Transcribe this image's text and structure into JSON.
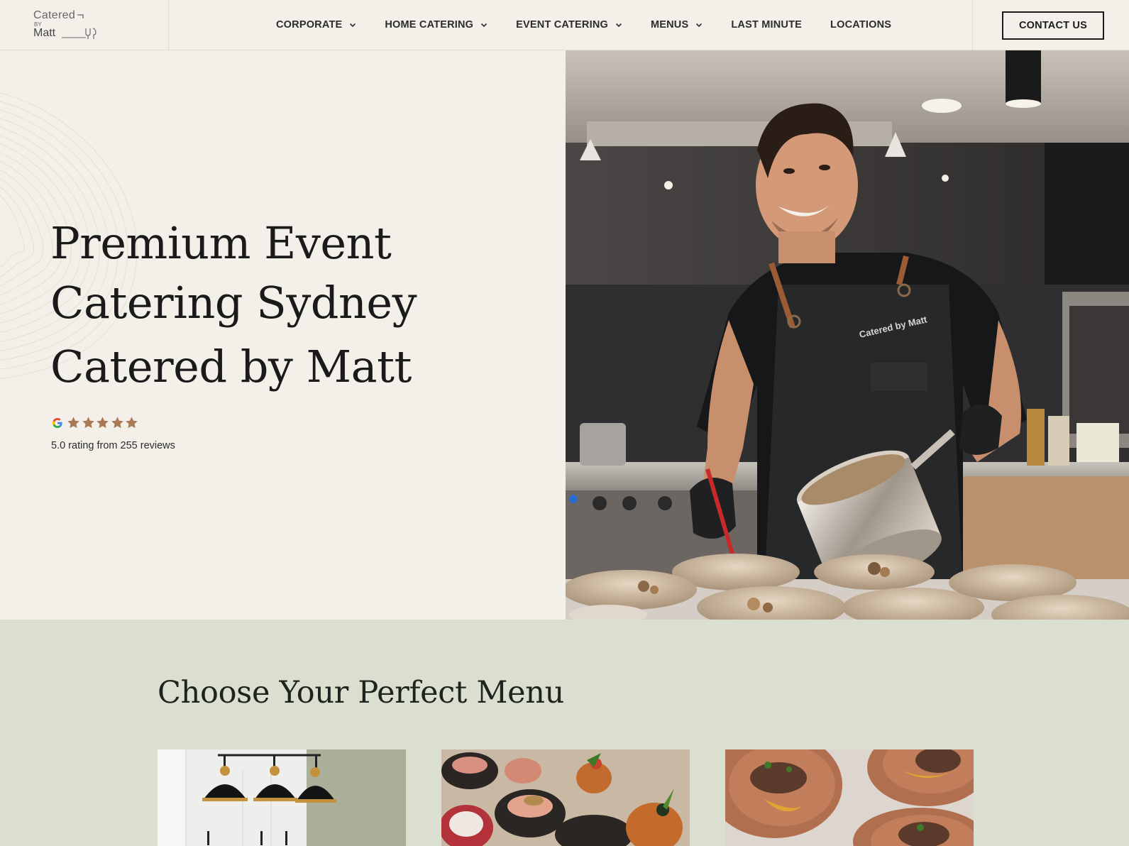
{
  "brand": {
    "logo_line1": "Catered",
    "logo_line2": "BY",
    "logo_line3": "Matt"
  },
  "nav": {
    "items": [
      {
        "label": "CORPORATE",
        "dropdown": true
      },
      {
        "label": "HOME CATERING",
        "dropdown": true
      },
      {
        "label": "EVENT CATERING",
        "dropdown": true
      },
      {
        "label": "MENUS",
        "dropdown": true
      },
      {
        "label": "LAST MINUTE",
        "dropdown": false
      },
      {
        "label": "LOCATIONS",
        "dropdown": false
      }
    ],
    "contact_label": "CONTACT US"
  },
  "hero": {
    "title_line1": "Premium Event",
    "title_line2": "Catering Sydney",
    "title_line3": "Catered by Matt",
    "rating_value": 5.0,
    "rating_stars": 5,
    "rating_text": "5.0 rating from 255 reviews",
    "image_apron_text": "Catered by Matt"
  },
  "menu_section": {
    "title": "Choose Your Perfect Menu"
  },
  "colors": {
    "background": "#f3f0e9",
    "section_background": "#dbdfd0",
    "star": "#a97953",
    "text": "#1c1c1c"
  },
  "icons": {
    "nav_dropdown": "chevron-down-icon",
    "rating_source": "google-icon",
    "rating_star": "star-icon",
    "logo_fork": "fork-icon"
  }
}
